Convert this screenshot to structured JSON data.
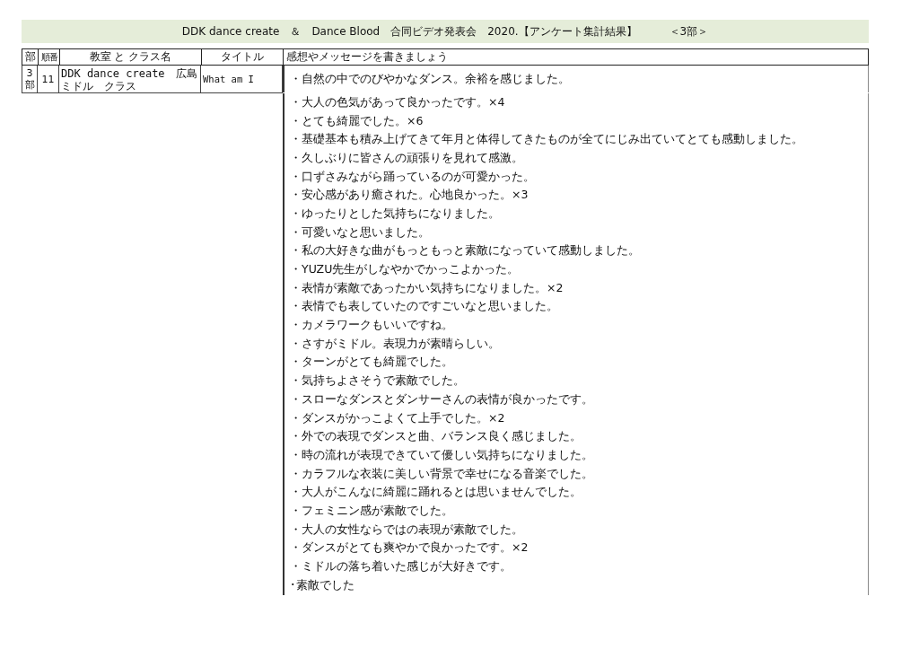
{
  "title": "DDK dance create　＆　Dance Blood　合同ビデオ発表会　2020.【アンケート集計結果】　　　＜3部＞",
  "table": {
    "columns": [
      "部",
      "順番",
      "教室 と クラス名",
      "タイトル",
      "感想やメッセージを書きましょう"
    ],
    "rows": [
      {
        "part": "3\n部",
        "order": "11",
        "class_name": [
          "DDK dance create　広島",
          "ミドル　クラス"
        ],
        "piece_title": "What am I",
        "comments": [
          "・自然の中でのびやかなダンス。余裕を感じました。",
          "・大人の色気があって良かったです。×4",
          "・とても綺麗でした。×6",
          "・基礎基本も積み上げてきて年月と体得してきたものが全てにじみ出ていてとても感動しました。",
          "・久しぶりに皆さんの頑張りを見れて感激。",
          "・口ずさみながら踊っているのが可愛かった。",
          "・安心感があり癒された。心地良かった。×3",
          "・ゆったりとした気持ちになりました。",
          "・可愛いなと思いました。",
          "・私の大好きな曲がもっともっと素敵になっていて感動しました。",
          "・YUZU先生がしなやかでかっこよかった。",
          "・表情が素敵であったかい気持ちになりました。×2",
          "・表情でも表していたのですごいなと思いました。",
          "・カメラワークもいいですね。",
          "・さすがミドル。表現力が素晴らしい。",
          "・ターンがとても綺麗でした。",
          "・気持ちよさそうで素敵でした。",
          "・スローなダンスとダンサーさんの表情が良かったです。",
          "・ダンスがかっこよくて上手でした。×2",
          "・外での表現でダンスと曲、バランス良く感じました。",
          "・時の流れが表現できていて優しい気持ちになりました。",
          "・カラフルな衣装に美しい背景で幸せになる音楽でした。",
          "・大人がこんなに綺麗に踊れるとは思いませんでした。",
          "・フェミニン感が素敵でした。",
          "・大人の女性ならではの表現が素敵でした。",
          "・ダンスがとても爽やかで良かったです。×2",
          "・ミドルの落ち着いた感じが大好きです。",
          "･素敵でした"
        ]
      }
    ]
  }
}
